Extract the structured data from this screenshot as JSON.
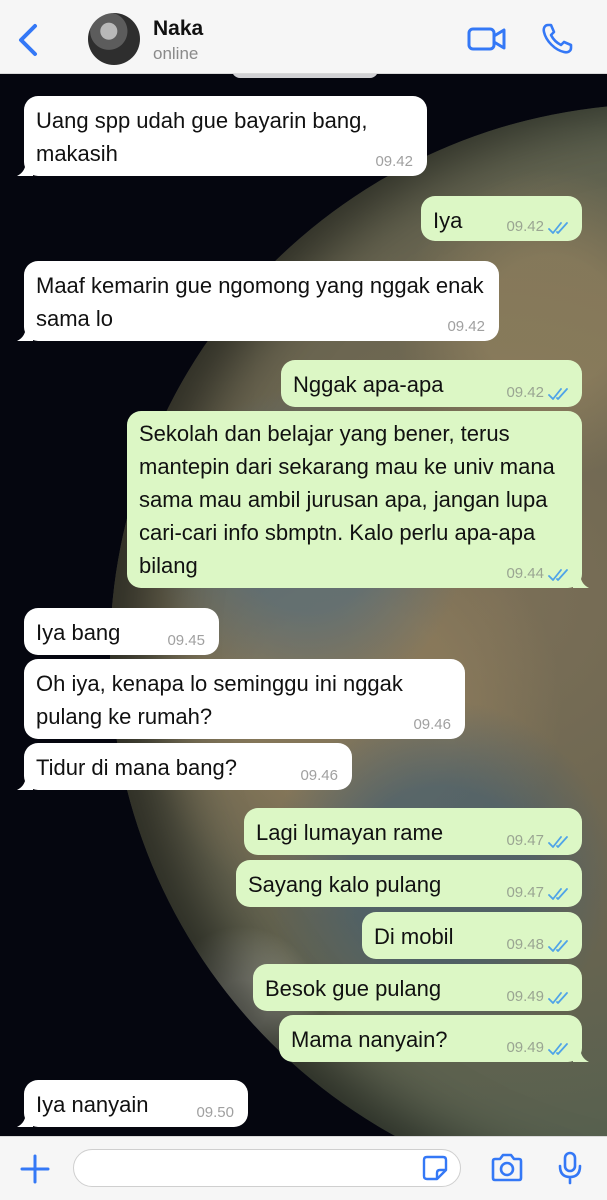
{
  "header": {
    "contact_name": "Naka",
    "status": "online",
    "accent_color": "#3478f6"
  },
  "messages": [
    {
      "direction": "in",
      "text": "Uang spp udah gue bayarin bang, makasih",
      "time": "09.42"
    },
    {
      "direction": "out",
      "text": "Iya",
      "time": "09.42",
      "read": true
    },
    {
      "direction": "in",
      "text": "Maaf kemarin gue ngomong yang nggak enak sama lo",
      "time": "09.42"
    },
    {
      "direction": "out",
      "text": "Nggak apa-apa",
      "time": "09.42",
      "read": true
    },
    {
      "direction": "out",
      "text": "Sekolah dan belajar yang bener, terus mantepin dari sekarang mau ke univ mana sama mau ambil jurusan apa, jangan lupa cari-cari info sbmptn. Kalo perlu apa-apa bilang",
      "time": "09.44",
      "read": true
    },
    {
      "direction": "in",
      "text": "Iya bang",
      "time": "09.45"
    },
    {
      "direction": "in",
      "text": "Oh iya, kenapa lo seminggu ini nggak pulang ke rumah?",
      "time": "09.46"
    },
    {
      "direction": "in",
      "text": "Tidur di mana bang?",
      "time": "09.46"
    },
    {
      "direction": "out",
      "text": "Lagi lumayan rame",
      "time": "09.47",
      "read": true
    },
    {
      "direction": "out",
      "text": "Sayang kalo pulang",
      "time": "09.47",
      "read": true
    },
    {
      "direction": "out",
      "text": "Di mobil",
      "time": "09.48",
      "read": true
    },
    {
      "direction": "out",
      "text": "Besok gue pulang",
      "time": "09.49",
      "read": true
    },
    {
      "direction": "out",
      "text": "Mama nanyain?",
      "time": "09.49",
      "read": true
    },
    {
      "direction": "in",
      "text": "Iya nanyain",
      "time": "09.50"
    }
  ],
  "input": {
    "value": "",
    "placeholder": ""
  },
  "colors": {
    "incoming_bubble": "#ffffff",
    "outgoing_bubble": "#dcf7c5",
    "read_ticks": "#4fa3e8"
  },
  "icons": {
    "back": "chevron-left-icon",
    "video": "video-camera-icon",
    "call": "phone-icon",
    "plus": "plus-icon",
    "sticker": "sticker-icon",
    "camera": "camera-icon",
    "mic": "microphone-icon"
  }
}
